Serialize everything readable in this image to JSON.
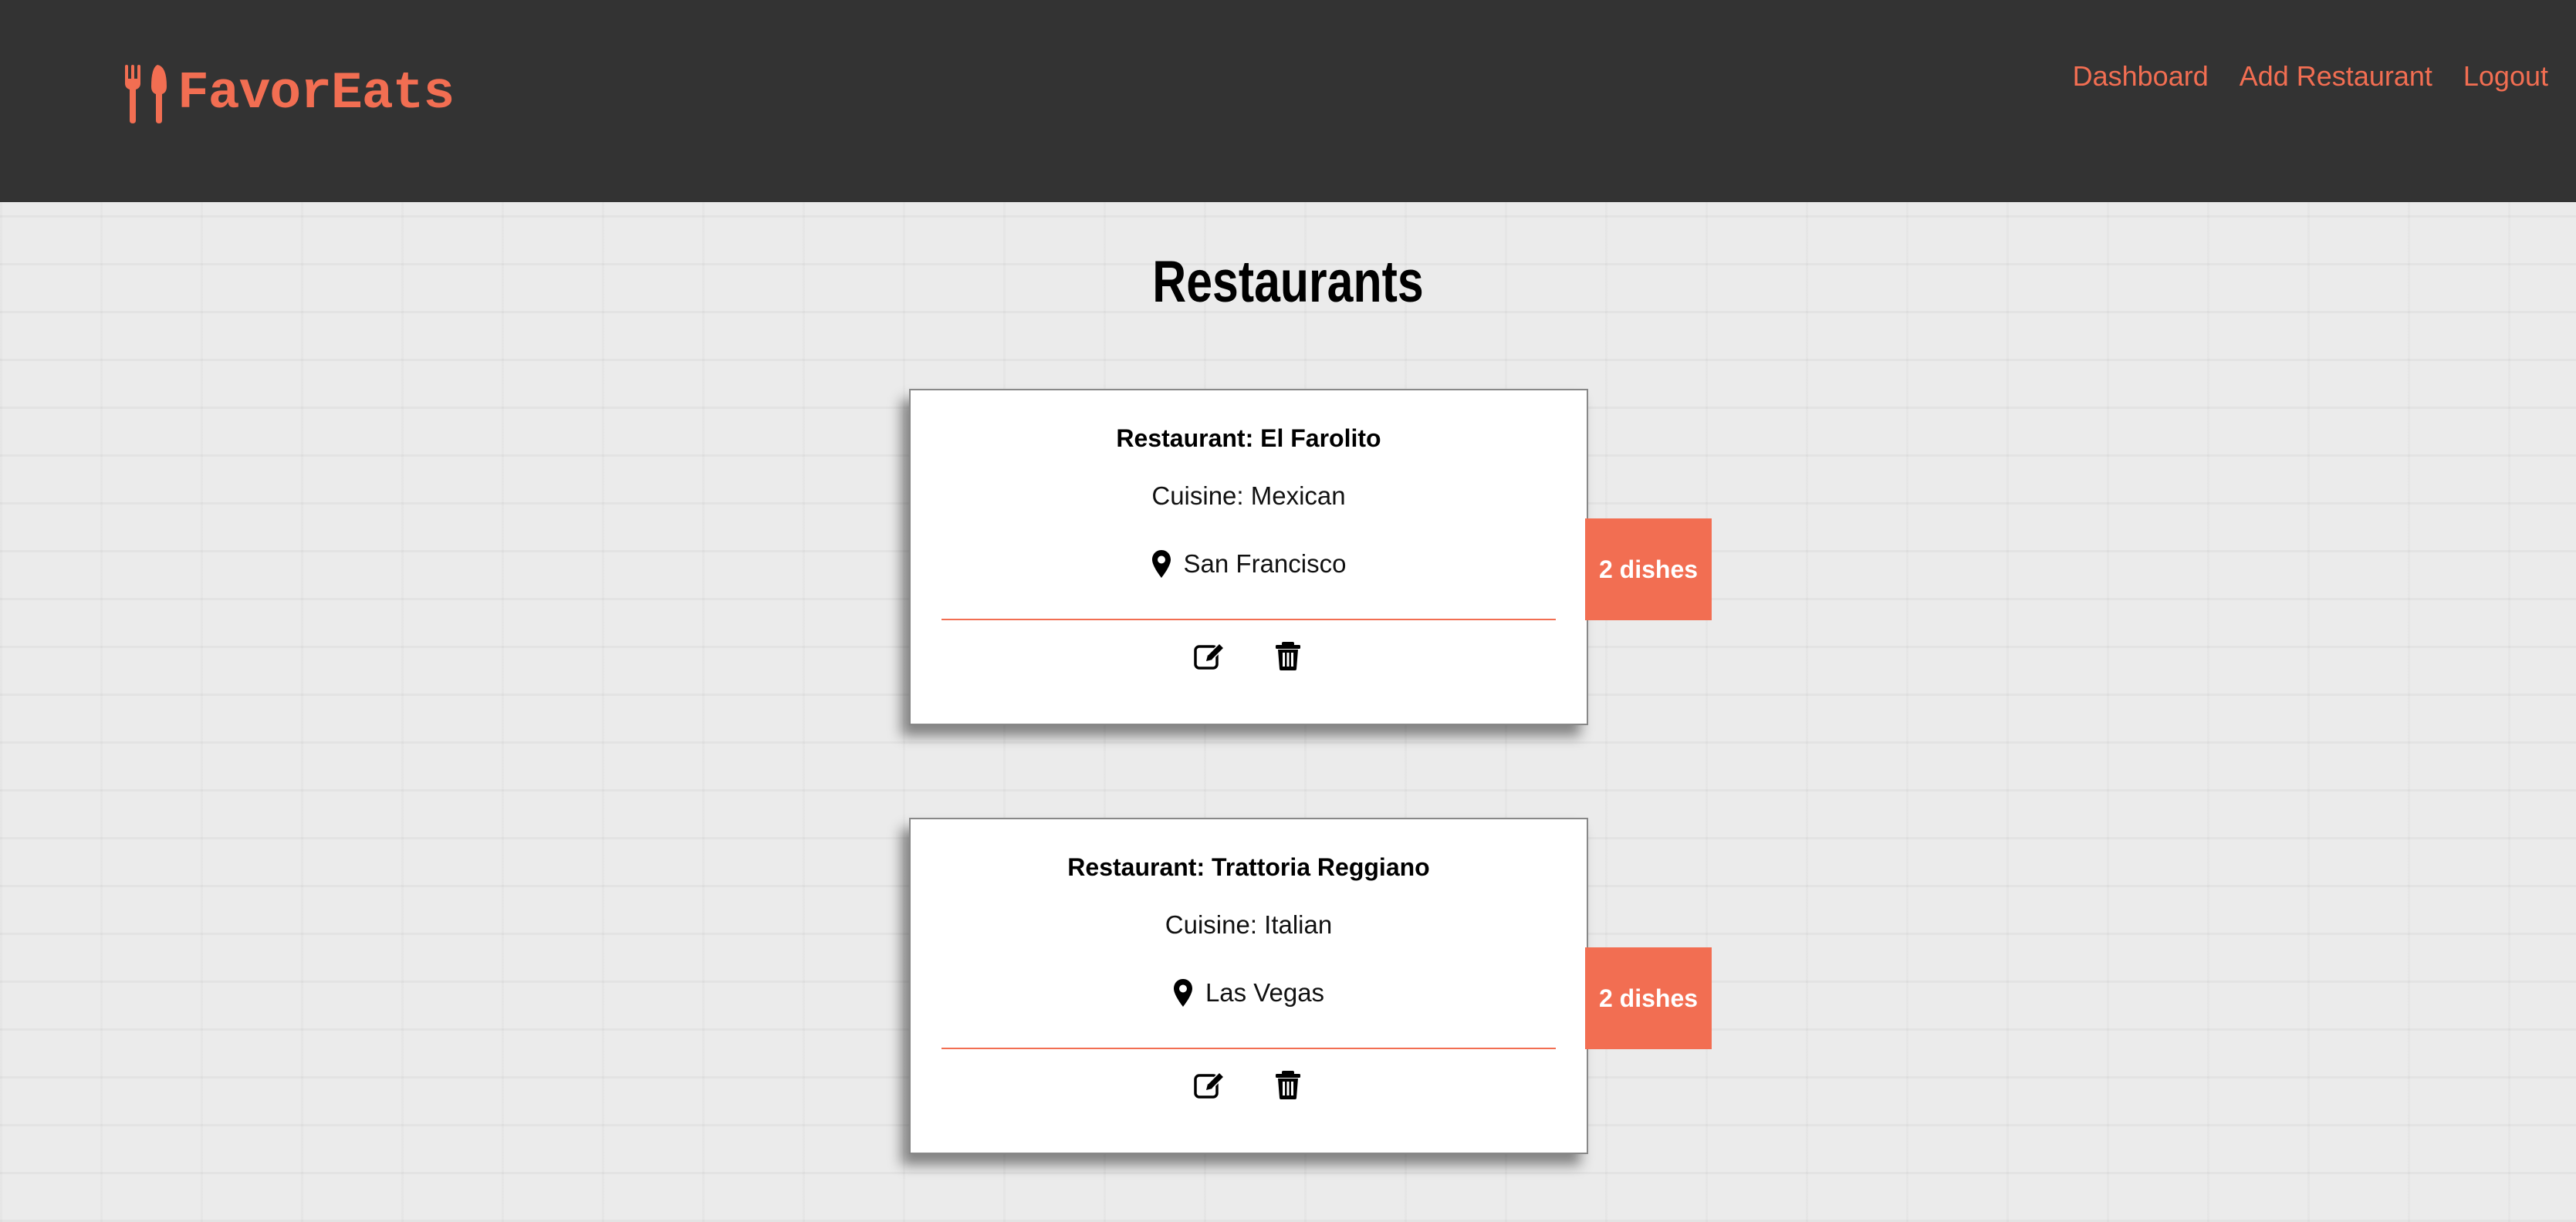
{
  "app": {
    "brand": "FavorEats",
    "accent_color": "#f26e52",
    "header_color": "#333333"
  },
  "nav": {
    "links": [
      {
        "label": "Dashboard"
      },
      {
        "label": "Add Restaurant"
      },
      {
        "label": "Logout"
      }
    ]
  },
  "page": {
    "title": "Restaurants"
  },
  "restaurants": [
    {
      "name": "Restaurant: El Farolito",
      "cuisine": "Cuisine: Mexican",
      "location": "San Francisco",
      "dishes": "2 dishes",
      "actions": [
        "edit-icon",
        "trash-icon"
      ]
    },
    {
      "name": "Restaurant: Trattoria Reggiano",
      "cuisine": "Cuisine: Italian",
      "location": "Las Vegas",
      "dishes": "2 dishes",
      "actions": [
        "edit-icon",
        "trash-icon"
      ]
    }
  ]
}
